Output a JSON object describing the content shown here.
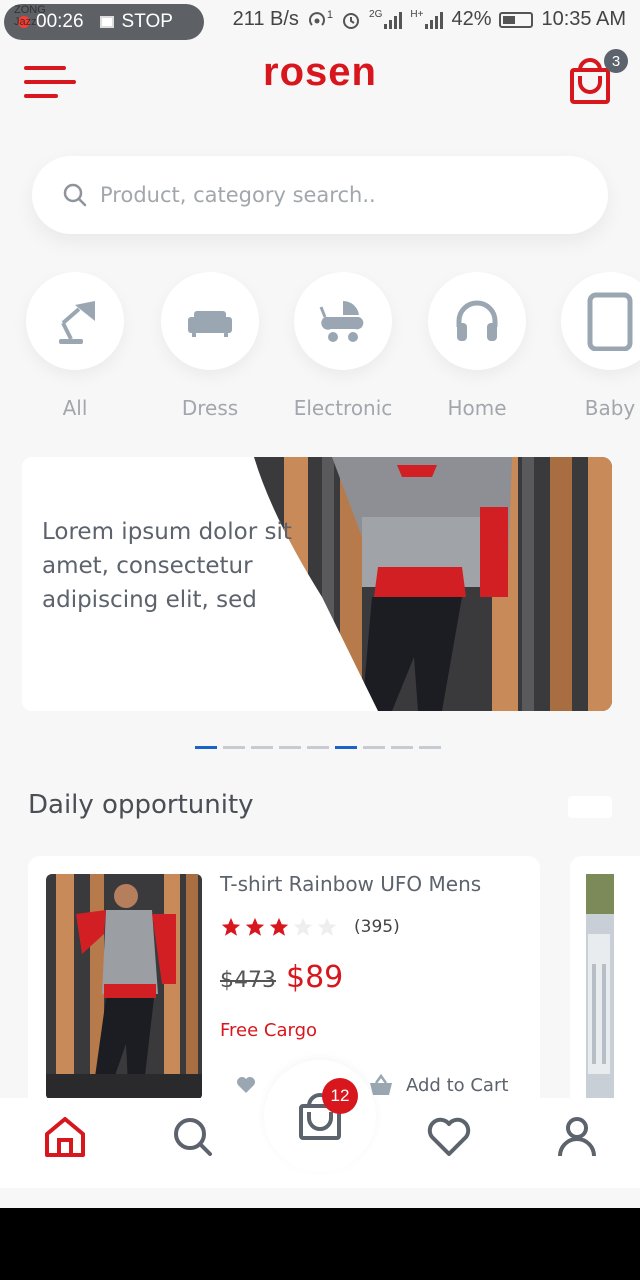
{
  "status_bar": {
    "carrier_top": "ZONG",
    "carrier_bottom": "Jazz",
    "record_time": "00:26",
    "stop_label": "STOP",
    "net_speed": "211 B/s",
    "battery": "42%",
    "time": "10:35 AM",
    "sup1": "1",
    "net1": "2G",
    "net2": "H+"
  },
  "header": {
    "logo": "rosen",
    "cart_count": "3"
  },
  "search": {
    "placeholder": "Product, category search.."
  },
  "categories": [
    {
      "label": "All",
      "icon": "desk-lamp-icon"
    },
    {
      "label": "Dress",
      "icon": "sofa-icon"
    },
    {
      "label": "Electronic",
      "icon": "stroller-icon"
    },
    {
      "label": "Home",
      "icon": "headphones-icon"
    },
    {
      "label": "Baby",
      "icon": "tablet-icon"
    }
  ],
  "banner": {
    "text": "Lorem ipsum dolor sit amet, consectetur adipiscing elit, sed",
    "pages": 9,
    "active_pages": [
      0,
      5
    ]
  },
  "daily": {
    "title": "Daily opportunity",
    "product": {
      "title": "T-shirt Rainbow UFO Mens",
      "rating": 3,
      "rating_max": 5,
      "reviews": "(395)",
      "old_price": "$473",
      "price": "$89",
      "cargo": "Free Cargo",
      "add_to_cart": "Add to Cart"
    }
  },
  "bottom_nav": {
    "cart_badge": "12"
  },
  "colors": {
    "brand": "#d8161d",
    "icon_gray": "#9aa7b3",
    "pager_active": "#1b63c7"
  }
}
